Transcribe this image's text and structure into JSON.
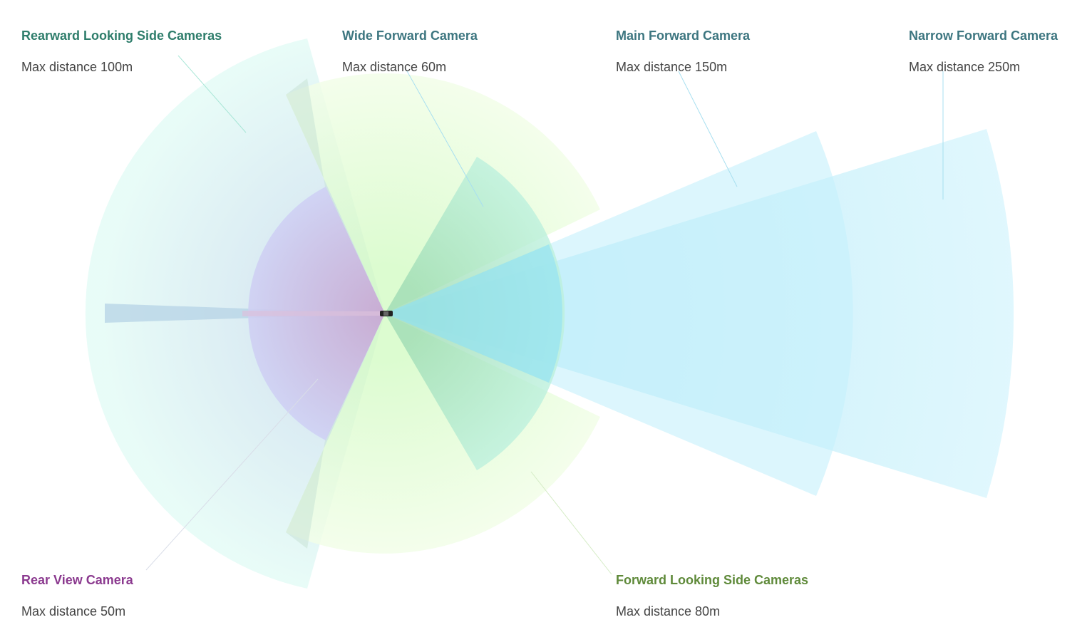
{
  "cameras": {
    "rearward_side": {
      "title": "Rearward Looking Side Cameras",
      "distance": "Max distance 100m",
      "color": "#2e7d6b",
      "fill": "#cfe9f0"
    },
    "wide_forward": {
      "title": "Wide Forward Camera",
      "distance": "Max distance 60m",
      "color": "#3d7680",
      "fill": "#a8e8cf"
    },
    "main_forward": {
      "title": "Main Forward Camera",
      "distance": "Max distance 150m",
      "color": "#3d7680",
      "fill": "#c4f0fb"
    },
    "narrow_forward": {
      "title": "Narrow Forward Camera",
      "distance": "Max distance 250m",
      "color": "#3d7680",
      "fill": "#bfeefc"
    },
    "rear_view": {
      "title": "Rear View Camera",
      "distance": "Max distance 50m",
      "color": "#8b3a8f",
      "fill": "#c4bff0"
    },
    "forward_side": {
      "title": "Forward Looking Side Cameras",
      "distance": "Max distance 80m",
      "color": "#5f8a3a",
      "fill": "#e2fbd0"
    }
  }
}
